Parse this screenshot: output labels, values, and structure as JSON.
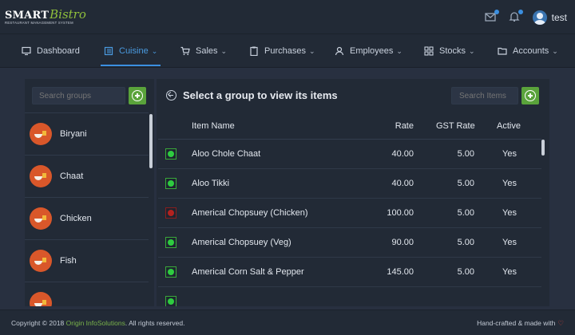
{
  "header": {
    "logo_primary": "SMART",
    "logo_secondary": "Bistro",
    "logo_tagline": "RESTAURANT MANAGEMENT SYSTEM",
    "mail_icon": "mail-icon",
    "bell_icon": "bell-icon",
    "username": "test"
  },
  "nav": {
    "items": [
      {
        "label": "Dashboard",
        "icon": "monitor-icon"
      },
      {
        "label": "Cuisine",
        "icon": "book-icon",
        "active": true
      },
      {
        "label": "Sales",
        "icon": "cart-icon"
      },
      {
        "label": "Purchases",
        "icon": "clipboard-icon"
      },
      {
        "label": "Employees",
        "icon": "users-icon"
      },
      {
        "label": "Stocks",
        "icon": "grid-icon"
      },
      {
        "label": "Accounts",
        "icon": "folder-icon"
      }
    ],
    "accent_color": "#3b8fe0"
  },
  "groups_panel": {
    "search_placeholder": "Search groups",
    "groups": [
      "Biryani",
      "Chaat",
      "Chicken",
      "Fish",
      ""
    ]
  },
  "items_panel": {
    "title": "Select a group to view its items",
    "search_placeholder": "Search Items",
    "columns": {
      "name": "Item Name",
      "rate": "Rate",
      "gst": "GST Rate",
      "active": "Active"
    },
    "rows": [
      {
        "type": "veg",
        "name": "Aloo Chole Chaat",
        "rate": "40.00",
        "gst": "5.00",
        "active": "Yes"
      },
      {
        "type": "veg",
        "name": "Aloo Tikki",
        "rate": "40.00",
        "gst": "5.00",
        "active": "Yes"
      },
      {
        "type": "nonveg",
        "name": "Americal Chopsuey (Chicken)",
        "rate": "100.00",
        "gst": "5.00",
        "active": "Yes"
      },
      {
        "type": "veg",
        "name": "Americal Chopsuey (Veg)",
        "rate": "90.00",
        "gst": "5.00",
        "active": "Yes"
      },
      {
        "type": "veg",
        "name": "Americal Corn Salt & Pepper",
        "rate": "145.00",
        "gst": "5.00",
        "active": "Yes"
      },
      {
        "type": "veg",
        "name": "",
        "rate": "",
        "gst": "",
        "active": ""
      }
    ],
    "veg_color": "#2ecc40",
    "nonveg_color": "#b3221f"
  },
  "footer": {
    "copyright_prefix": "Copyright © 2018 ",
    "company": "Origin InfoSolutions",
    "copyright_suffix": ". All rights reserved.",
    "made_with": "Hand-crafted & made with",
    "heart": "♡"
  }
}
